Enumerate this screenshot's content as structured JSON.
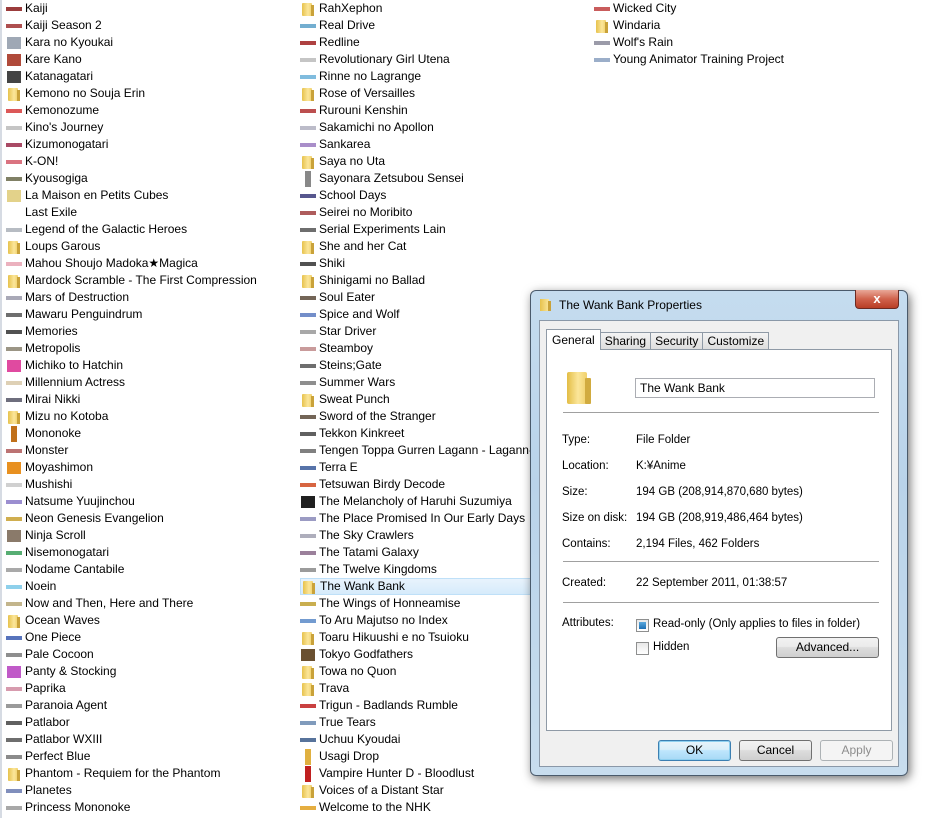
{
  "explorer": {
    "columns": [
      [
        {
          "name": "Kaiji",
          "icon": "thumb",
          "color": "#8a1a1a"
        },
        {
          "name": "Kaiji Season 2",
          "icon": "thumb",
          "color": "#a03030"
        },
        {
          "name": "Kara no Kyoukai",
          "icon": "square",
          "color": "#9fa8b5"
        },
        {
          "name": "Kare Kano",
          "icon": "square",
          "color": "#b04a3a"
        },
        {
          "name": "Katanagatari",
          "icon": "square",
          "color": "#444444"
        },
        {
          "name": "Kemono no Souja Erin",
          "icon": "folder"
        },
        {
          "name": "Kemonozume",
          "icon": "thumb",
          "color": "#d63b3b"
        },
        {
          "name": "Kino's Journey",
          "icon": "thumb",
          "color": "#bbbbbb"
        },
        {
          "name": "Kizumonogatari",
          "icon": "thumb",
          "color": "#9a2a4a"
        },
        {
          "name": "K-ON!",
          "icon": "thumb",
          "color": "#d45a6a"
        },
        {
          "name": "Kyousogiga",
          "icon": "thumb",
          "color": "#6a6a4a"
        },
        {
          "name": "La Maison en Petits Cubes",
          "icon": "square",
          "color": "#e3d28a"
        },
        {
          "name": "Last Exile",
          "icon": "blank"
        },
        {
          "name": "Legend of the Galactic Heroes",
          "icon": "thumb",
          "color": "#aab0b8"
        },
        {
          "name": "Loups Garous",
          "icon": "folder"
        },
        {
          "name": "Mahou Shoujo Madoka★Magica",
          "icon": "thumb",
          "color": "#e7a3b3"
        },
        {
          "name": "Mardock Scramble - The First Compression",
          "icon": "folder"
        },
        {
          "name": "Mars of Destruction",
          "icon": "thumb",
          "color": "#9a9aaa"
        },
        {
          "name": "Mawaru Penguindrum",
          "icon": "thumb",
          "color": "#555555"
        },
        {
          "name": "Memories",
          "icon": "thumb",
          "color": "#333333"
        },
        {
          "name": "Metropolis",
          "icon": "thumb",
          "color": "#8a8270"
        },
        {
          "name": "Michiko to Hatchin",
          "icon": "square",
          "color": "#e04aa0"
        },
        {
          "name": "Millennium Actress",
          "icon": "thumb",
          "color": "#d8c8a8"
        },
        {
          "name": "Mirai Nikki",
          "icon": "thumb",
          "color": "#555566"
        },
        {
          "name": "Mizu no Kotoba",
          "icon": "folder"
        },
        {
          "name": "Mononoke",
          "icon": "tall",
          "color": "#c0701a"
        },
        {
          "name": "Monster",
          "icon": "thumb",
          "color": "#b05a5a"
        },
        {
          "name": "Moyashimon",
          "icon": "square",
          "color": "#e89020"
        },
        {
          "name": "Mushishi",
          "icon": "thumb",
          "color": "#c8c8c8"
        },
        {
          "name": "Natsume Yuujinchou",
          "icon": "thumb",
          "color": "#8a7ac8"
        },
        {
          "name": "Neon Genesis Evangelion",
          "icon": "thumb",
          "color": "#c8a030"
        },
        {
          "name": "Ninja Scroll",
          "icon": "square",
          "color": "#8a7a6a"
        },
        {
          "name": "Nisemonogatari",
          "icon": "thumb",
          "color": "#3aa05a"
        },
        {
          "name": "Nodame Cantabile",
          "icon": "thumb",
          "color": "#9a9a9a"
        },
        {
          "name": "Noein",
          "icon": "thumb",
          "color": "#7ac8e8"
        },
        {
          "name": "Now and Then, Here and There",
          "icon": "thumb",
          "color": "#b8a878"
        },
        {
          "name": "Ocean Waves",
          "icon": "folder"
        },
        {
          "name": "One Piece",
          "icon": "thumb",
          "color": "#3a5ab0"
        },
        {
          "name": "Pale Cocoon",
          "icon": "thumb",
          "color": "#7a7a7a"
        },
        {
          "name": "Panty & Stocking",
          "icon": "square",
          "color": "#c05ac8"
        },
        {
          "name": "Paprika",
          "icon": "thumb",
          "color": "#d08aa0"
        },
        {
          "name": "Paranoia Agent",
          "icon": "thumb",
          "color": "#888888"
        },
        {
          "name": "Patlabor",
          "icon": "thumb",
          "color": "#444444"
        },
        {
          "name": "Patlabor WXIII",
          "icon": "thumb",
          "color": "#555555"
        },
        {
          "name": "Perfect Blue",
          "icon": "thumb",
          "color": "#777777"
        },
        {
          "name": "Phantom - Requiem for the Phantom",
          "icon": "folder"
        },
        {
          "name": "Planetes",
          "icon": "thumb",
          "color": "#6a7ab0"
        },
        {
          "name": "Princess Mononoke",
          "icon": "thumb",
          "color": "#999999"
        }
      ],
      [
        {
          "name": "RahXephon",
          "icon": "folder"
        },
        {
          "name": "Real Drive",
          "icon": "thumb",
          "color": "#5aa0c8"
        },
        {
          "name": "Redline",
          "icon": "thumb",
          "color": "#a02020"
        },
        {
          "name": "Revolutionary Girl Utena",
          "icon": "thumb",
          "color": "#bbbbbb"
        },
        {
          "name": "Rinne no Lagrange",
          "icon": "thumb",
          "color": "#6ab0d8"
        },
        {
          "name": "Rose of Versailles",
          "icon": "folder"
        },
        {
          "name": "Rurouni Kenshin",
          "icon": "thumb",
          "color": "#b03030"
        },
        {
          "name": "Sakamichi no Apollon",
          "icon": "thumb",
          "color": "#b0b0c0"
        },
        {
          "name": "Sankarea",
          "icon": "thumb",
          "color": "#9a7ac0"
        },
        {
          "name": "Saya no Uta",
          "icon": "folder"
        },
        {
          "name": "Sayonara Zetsubou Sensei",
          "icon": "tall",
          "color": "#888888"
        },
        {
          "name": "School Days",
          "icon": "thumb",
          "color": "#3a3a7a"
        },
        {
          "name": "Seirei no Moribito",
          "icon": "thumb",
          "color": "#a04040"
        },
        {
          "name": "Serial Experiments Lain",
          "icon": "thumb",
          "color": "#555555"
        },
        {
          "name": "She and her Cat",
          "icon": "folder"
        },
        {
          "name": "Shiki",
          "icon": "thumb",
          "color": "#333333"
        },
        {
          "name": "Shinigami no Ballad",
          "icon": "folder"
        },
        {
          "name": "Soul Eater",
          "icon": "thumb",
          "color": "#5a4a3a"
        },
        {
          "name": "Spice and Wolf",
          "icon": "thumb",
          "color": "#5a7ac0"
        },
        {
          "name": "Star Driver",
          "icon": "thumb",
          "color": "#999999"
        },
        {
          "name": "Steamboy",
          "icon": "thumb",
          "color": "#c08a8a"
        },
        {
          "name": "Steins;Gate",
          "icon": "thumb",
          "color": "#555555"
        },
        {
          "name": "Summer Wars",
          "icon": "thumb",
          "color": "#7a7a7a"
        },
        {
          "name": "Sweat Punch",
          "icon": "folder"
        },
        {
          "name": "Sword of the Stranger",
          "icon": "thumb",
          "color": "#5a4a3a"
        },
        {
          "name": "Tekkon Kinkreet",
          "icon": "thumb",
          "color": "#444444"
        },
        {
          "name": "Tengen Toppa Gurren Lagann - Lagann-hen",
          "icon": "thumb",
          "color": "#6a6a6a"
        },
        {
          "name": "Terra E",
          "icon": "thumb",
          "color": "#3a5a9a"
        },
        {
          "name": "Tetsuwan Birdy Decode",
          "icon": "thumb",
          "color": "#d04a20"
        },
        {
          "name": "The Melancholy of Haruhi Suzumiya",
          "icon": "square",
          "color": "#202020"
        },
        {
          "name": "The Place Promised In Our Early Days",
          "icon": "thumb",
          "color": "#8a8ab8"
        },
        {
          "name": "The Sky Crawlers",
          "icon": "thumb",
          "color": "#a0a0b0"
        },
        {
          "name": "The Tatami Galaxy",
          "icon": "thumb",
          "color": "#8a6a8a"
        },
        {
          "name": "The Twelve Kingdoms",
          "icon": "thumb",
          "color": "#8a8a8a"
        },
        {
          "name": "The Wank Bank",
          "icon": "folder",
          "selected": true
        },
        {
          "name": "The Wings of Honneamise",
          "icon": "thumb",
          "color": "#c0a030"
        },
        {
          "name": "To Aru Majutso no Index",
          "icon": "thumb",
          "color": "#5a8ac8"
        },
        {
          "name": "Toaru Hikuushi e no Tsuioku",
          "icon": "folder"
        },
        {
          "name": "Tokyo Godfathers",
          "icon": "square",
          "color": "#6a5030"
        },
        {
          "name": "Towa no Quon",
          "icon": "folder"
        },
        {
          "name": "Trava",
          "icon": "folder"
        },
        {
          "name": "Trigun - Badlands Rumble",
          "icon": "thumb",
          "color": "#c02020"
        },
        {
          "name": "True Tears",
          "icon": "thumb",
          "color": "#6a8ab0"
        },
        {
          "name": "Uchuu Kyoudai",
          "icon": "thumb",
          "color": "#3a5a8a"
        },
        {
          "name": "Usagi Drop",
          "icon": "tall",
          "color": "#e0b040"
        },
        {
          "name": "Vampire Hunter D - Bloodlust",
          "icon": "tall",
          "color": "#c02020"
        },
        {
          "name": "Voices of a Distant Star",
          "icon": "folder"
        },
        {
          "name": "Welcome to the NHK",
          "icon": "thumb",
          "color": "#e0a020"
        }
      ],
      [
        {
          "name": "Wicked City",
          "icon": "thumb",
          "color": "#c04040"
        },
        {
          "name": "Windaria",
          "icon": "folder"
        },
        {
          "name": "Wolf's Rain",
          "icon": "thumb",
          "color": "#8a8a9a"
        },
        {
          "name": "Young Animator Training Project",
          "icon": "thumb",
          "color": "#8aa0c0"
        }
      ]
    ]
  },
  "dialog": {
    "title": "The Wank Bank Properties",
    "close_label": "x",
    "tabs": [
      "General",
      "Sharing",
      "Security",
      "Customize"
    ],
    "active_tab": "General",
    "name_value": "The Wank Bank",
    "properties": {
      "type_label": "Type:",
      "type_value": "File Folder",
      "location_label": "Location:",
      "location_value": "K:¥Anime",
      "size_label": "Size:",
      "size_value": "194 GB (208,914,870,680 bytes)",
      "size_on_disk_label": "Size on disk:",
      "size_on_disk_value": "194 GB (208,919,486,464 bytes)",
      "contains_label": "Contains:",
      "contains_value": "2,194 Files, 462 Folders",
      "created_label": "Created:",
      "created_value": "22 September 2011, 01:38:57",
      "attributes_label": "Attributes:"
    },
    "attributes": {
      "readonly_label": "Read-only (Only applies to files in folder)",
      "readonly_state": "indeterminate",
      "hidden_label": "Hidden",
      "hidden_state": "unchecked",
      "advanced_label": "Advanced..."
    },
    "buttons": {
      "ok": "OK",
      "cancel": "Cancel",
      "apply": "Apply"
    }
  }
}
